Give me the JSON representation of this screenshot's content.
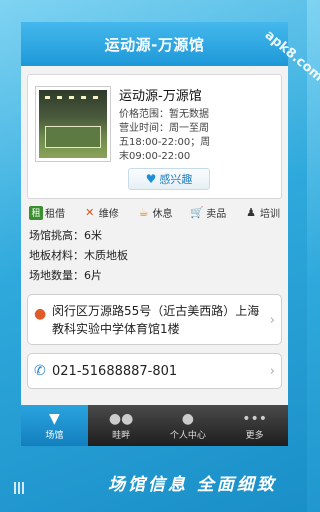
{
  "app": {
    "title": "运动源-万源馆"
  },
  "venue": {
    "name": "运动源-万源馆",
    "price_range": "价格范围：暂无数据",
    "hours_line1": "营业时间：周一至周",
    "hours_line2": "五18:00-22:00；周",
    "hours_line3": "末09:00-22:00",
    "interest_label": "感兴趣"
  },
  "services": [
    {
      "icon": "rent-icon",
      "label": "租借"
    },
    {
      "icon": "repair-icon",
      "label": "维修"
    },
    {
      "icon": "rest-icon",
      "label": "休息"
    },
    {
      "icon": "shop-icon",
      "label": "卖品"
    },
    {
      "icon": "training-icon",
      "label": "培训"
    }
  ],
  "attributes": [
    "场馆挑高：6米",
    "地板材料：木质地板",
    "场地数量：6片"
  ],
  "address": "闵行区万源路55号（近古美西路）上海教科实验中学体育馆1楼",
  "phone": "021-51688887-801",
  "tabs": [
    {
      "icon": "shuttlecock-icon",
      "label": "场馆"
    },
    {
      "icon": "chat-icon",
      "label": "畦畔"
    },
    {
      "icon": "person-icon",
      "label": "个人中心"
    },
    {
      "icon": "more-icon",
      "label": "更多"
    }
  ],
  "banner": "场馆信息 全面细致",
  "watermark": "apk8.com",
  "colors": {
    "accent": "#1d98d8",
    "background": "#2fa9dc"
  }
}
